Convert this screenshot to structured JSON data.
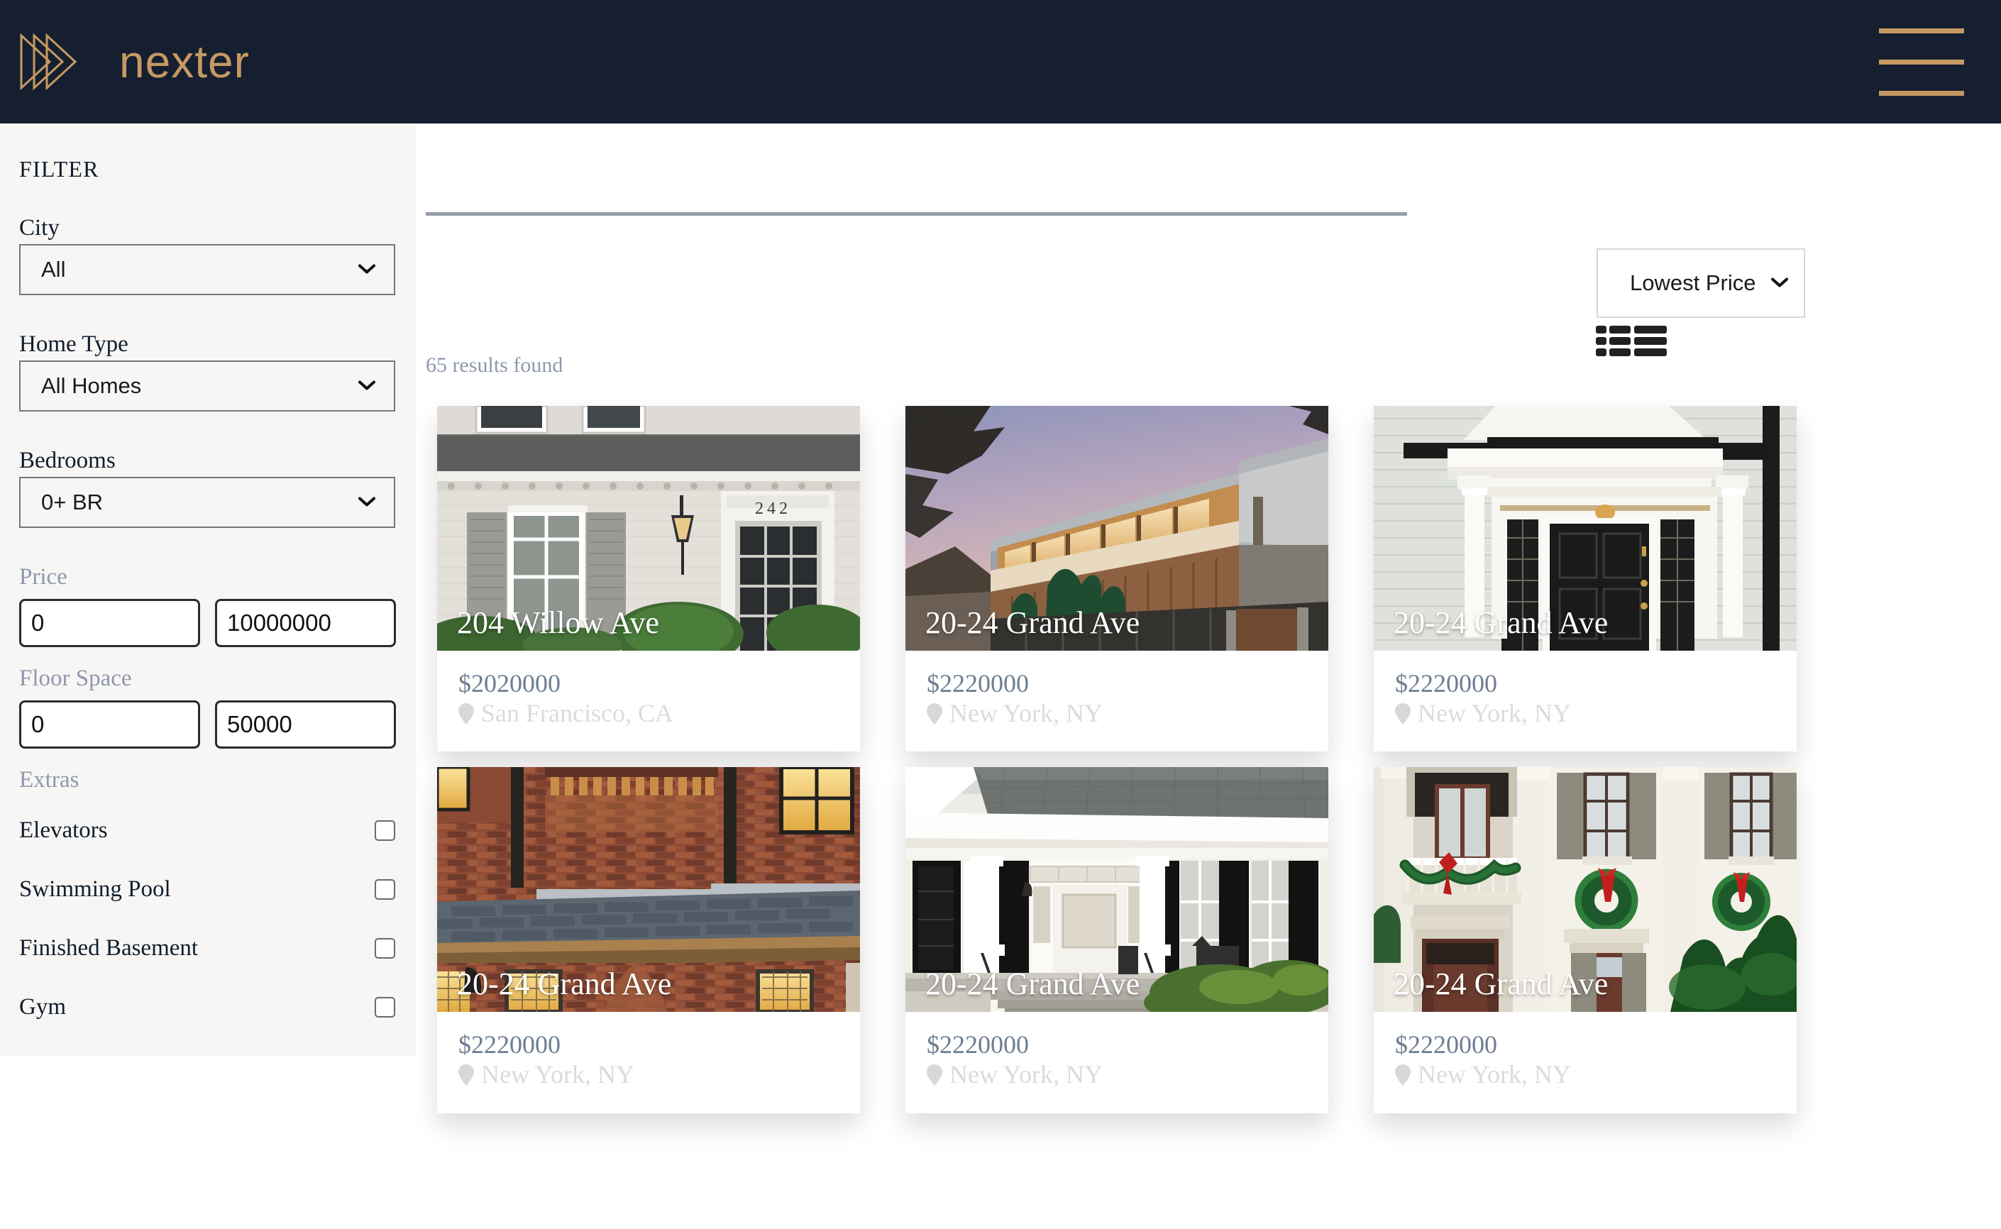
{
  "brand": {
    "name": "nexter",
    "logo_icon": "triple-chevron-play-icon",
    "accent_color": "#c69963",
    "header_bg": "#151f30",
    "menu_icon": "hamburger-menu-icon"
  },
  "sidebar": {
    "title": "FILTER",
    "fields": [
      {
        "label": "City",
        "value": "All",
        "icon": "chevron-down-icon"
      },
      {
        "label": "Home Type",
        "value": "All Homes",
        "icon": "chevron-down-icon"
      },
      {
        "label": "Bedrooms",
        "value": "0+ BR",
        "icon": "chevron-down-icon"
      }
    ],
    "price": {
      "label": "Price",
      "min": "0",
      "max": "10000000"
    },
    "floor_space": {
      "label": "Floor Space",
      "min": "0",
      "max": "50000"
    },
    "extras": {
      "label": "Extras",
      "items": [
        {
          "label": "Elevators",
          "checked": false
        },
        {
          "label": "Swimming Pool",
          "checked": false
        },
        {
          "label": "Finished Basement",
          "checked": false
        },
        {
          "label": "Gym",
          "checked": false
        }
      ]
    }
  },
  "main": {
    "results_text": "65 results found",
    "sort": {
      "value": "Lowest Price",
      "icon": "chevron-down-icon"
    },
    "view_toggle": [
      {
        "icon": "list-view-icon",
        "active": true
      },
      {
        "icon": "grid-view-icon",
        "active": false
      }
    ],
    "listings": [
      {
        "title": "204 Willow Ave",
        "price": "$2020000",
        "location": "San Francisco, CA",
        "pin_icon": "map-pin-icon",
        "photo": "white-colonial-house"
      },
      {
        "title": "20-24 Grand Ave",
        "price": "$2220000",
        "location": "New York, NY",
        "pin_icon": "map-pin-icon",
        "photo": "modern-house-dusk"
      },
      {
        "title": "20-24 Grand Ave",
        "price": "$2220000",
        "location": "New York, NY",
        "pin_icon": "map-pin-icon",
        "photo": "white-portico-black-door"
      },
      {
        "title": "20-24 Grand Ave",
        "price": "$2220000",
        "location": "New York, NY",
        "pin_icon": "map-pin-icon",
        "photo": "brick-tudor-dusk"
      },
      {
        "title": "20-24 Grand Ave",
        "price": "$2220000",
        "location": "New York, NY",
        "pin_icon": "map-pin-icon",
        "photo": "white-farmhouse-porch"
      },
      {
        "title": "20-24 Grand Ave",
        "price": "$2220000",
        "location": "New York, NY",
        "pin_icon": "map-pin-icon",
        "photo": "mansion-christmas-wreaths"
      }
    ]
  },
  "colors": {
    "price_text": "#6e7d90",
    "location_text": "#dbdbdb",
    "muted_label": "#8d98ab",
    "rule": "#949daa",
    "sidebar_bg": "#f7f6f4"
  }
}
